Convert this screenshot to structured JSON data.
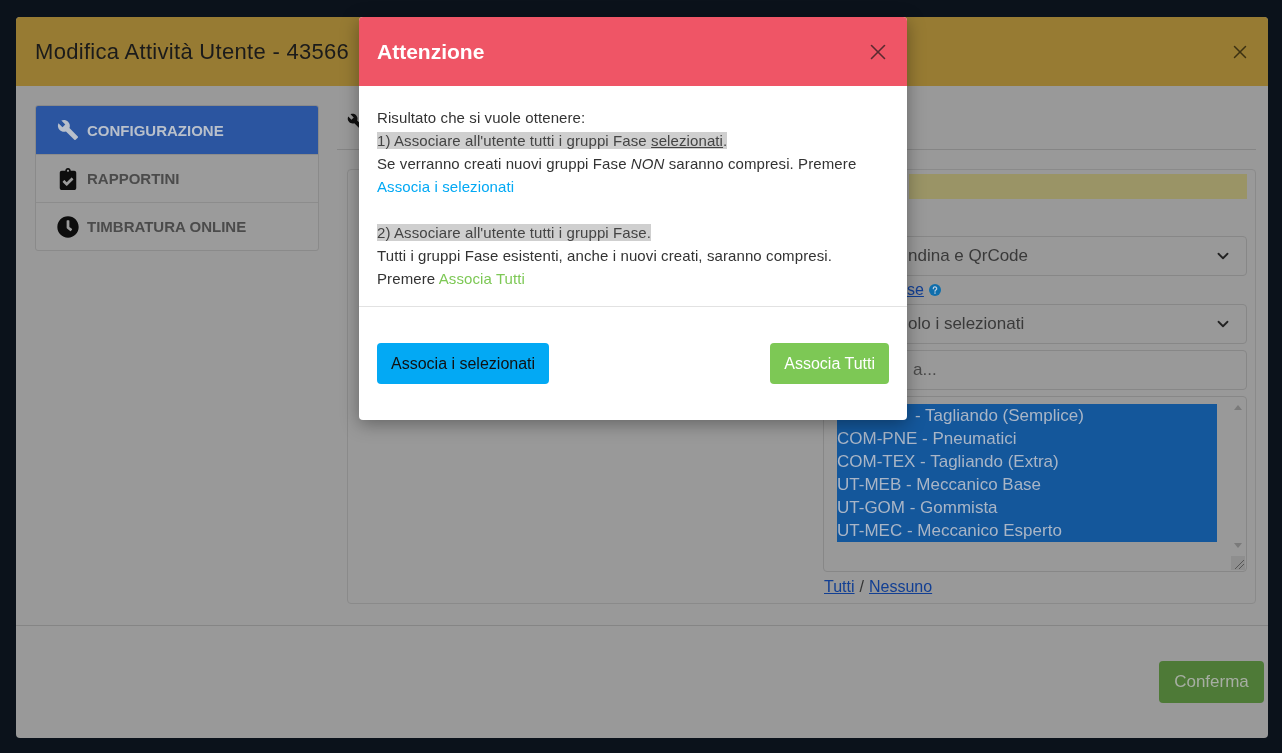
{
  "window": {
    "title": "Modifica Attività Utente - 43566"
  },
  "sidebar": {
    "items": [
      {
        "label": "CONFIGURAZIONE",
        "selected": true
      },
      {
        "label": "RAPPORTINI",
        "selected": false
      },
      {
        "label": "TIMBRATURA ONLINE",
        "selected": false
      }
    ]
  },
  "form": {
    "mode_select": {
      "value": "ndina e QrCode"
    },
    "groups_link": {
      "label": "se"
    },
    "groups_select": {
      "value": "olo i selezionati"
    },
    "search": {
      "placeholder": "a..."
    },
    "groups_list": {
      "items": [
        {
          "label": "- Tagliando (Semplice)",
          "selected": true,
          "clipped": true
        },
        {
          "label": "COM-PNE - Pneumatici",
          "selected": true,
          "clipped": false
        },
        {
          "label": "COM-TEX - Tagliando (Extra)",
          "selected": true,
          "clipped": false
        },
        {
          "label": "UT-MEB - Meccanico Base",
          "selected": true,
          "clipped": false
        },
        {
          "label": "UT-GOM - Gommista",
          "selected": true,
          "clipped": false
        },
        {
          "label": "UT-MEC - Meccanico Esperto",
          "selected": true,
          "clipped": false
        }
      ]
    },
    "select_links": {
      "all": "Tutti",
      "separator": "/",
      "none": "Nessuno"
    }
  },
  "footer": {
    "confirm_button": "Conferma"
  },
  "alert_dialog": {
    "title": "Attenzione",
    "intro": "Risultato che si vuole ottenere:",
    "options": [
      {
        "heading": {
          "text": "1) Associare all'utente tutti i gruppi Fase ",
          "underlined": "selezionati",
          "end": "."
        },
        "description": "Se verranno creati nuovi gruppi Fase *NON* saranno compresi. Premere",
        "link": {
          "label": "Associa i selezionati",
          "kind": "primary"
        }
      },
      {
        "heading": {
          "text": "2) Associare all'utente tutti i gruppi Fase."
        },
        "description": "Tutti i gruppi Fase esistenti, anche i nuovi creati, saranno compresi. Premere",
        "link": {
          "label": "Associa Tutti",
          "kind": "success"
        }
      }
    ],
    "buttons": [
      {
        "label": "Associa i selezionati",
        "kind": "primary"
      },
      {
        "label": "Associa Tutti",
        "kind": "success"
      }
    ]
  }
}
